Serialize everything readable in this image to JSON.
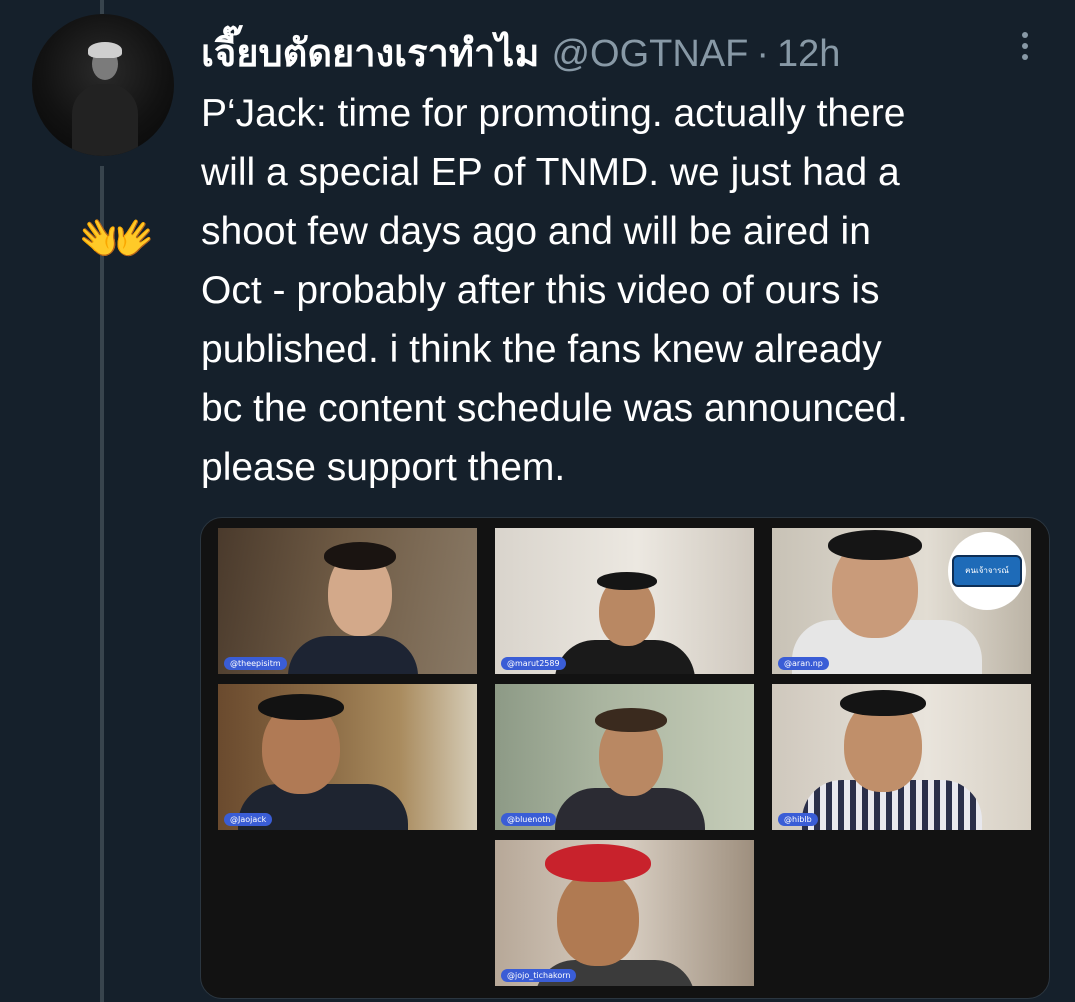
{
  "tweet": {
    "display_name": "เจี๊ยบตัดยางเราทำไม",
    "handle": "@OGTNAF",
    "separator": "·",
    "time": "12h",
    "reaction_emoji": "👐",
    "text_lines": [
      "P‘Jack: time for promoting. actually there",
      "will a special EP of TNMD. we just had a",
      "shoot few days ago and will be aired in",
      "Oct - probably after this video of ours is",
      "published. i think the fans knew already",
      "bc the content schedule was announced.",
      "please support them."
    ]
  },
  "media": {
    "participants": [
      {
        "label": "@theepisitm"
      },
      {
        "label": "@marut2589"
      },
      {
        "label": "@aran.np"
      },
      {
        "label": "@Jaojack"
      },
      {
        "label": "@bluenoth"
      },
      {
        "label": "@hiblb"
      },
      {
        "label": "@jojo_tichakorn"
      }
    ],
    "badge_text": "ฅนเจ้าจารณ์"
  },
  "colors": {
    "background": "#15202b",
    "text_primary": "#ffffff",
    "text_secondary": "#8899a6",
    "thread_line": "#38444d",
    "name_tag": "#3a5dd6"
  },
  "icons": {
    "more": "more-vertical-icon",
    "reaction": "open-hands-emoji"
  }
}
